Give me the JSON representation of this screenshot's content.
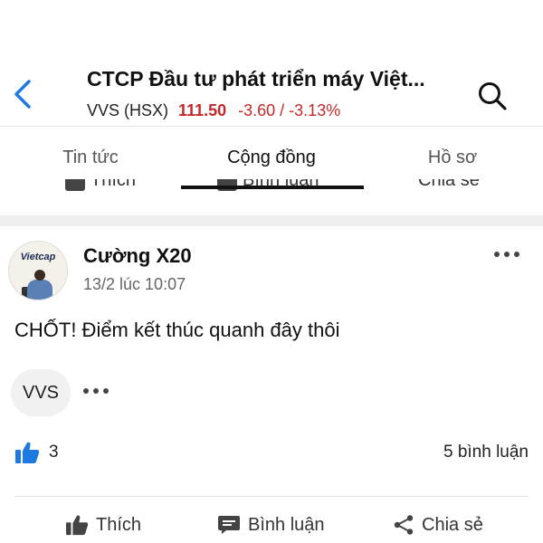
{
  "header": {
    "title": "CTCP Đầu tư phát triển máy Việt...",
    "symbol": "VVS (HSX)",
    "price": "111.50",
    "change": "-3.60 / -3.13%"
  },
  "tabs": [
    {
      "label": "Tin tức"
    },
    {
      "label": "Cộng đồng"
    },
    {
      "label": "Hồ sơ"
    }
  ],
  "peek_actions": [
    "Thích",
    "Bình luận",
    "Chia sẻ"
  ],
  "post": {
    "avatar_logo": "Vietcap",
    "author": "Cường X20",
    "time": "13/2 lúc 10:07",
    "content": "CHỐT! Điểm kết thúc quanh đây thôi",
    "tag": "VVS",
    "likes": "3",
    "comments": "5 bình luận"
  },
  "actions": {
    "like": "Thích",
    "comment": "Bình luận",
    "share": "Chia sẻ"
  },
  "colors": {
    "accent_blue": "#1e7ae0",
    "negative_red": "#c62828"
  }
}
